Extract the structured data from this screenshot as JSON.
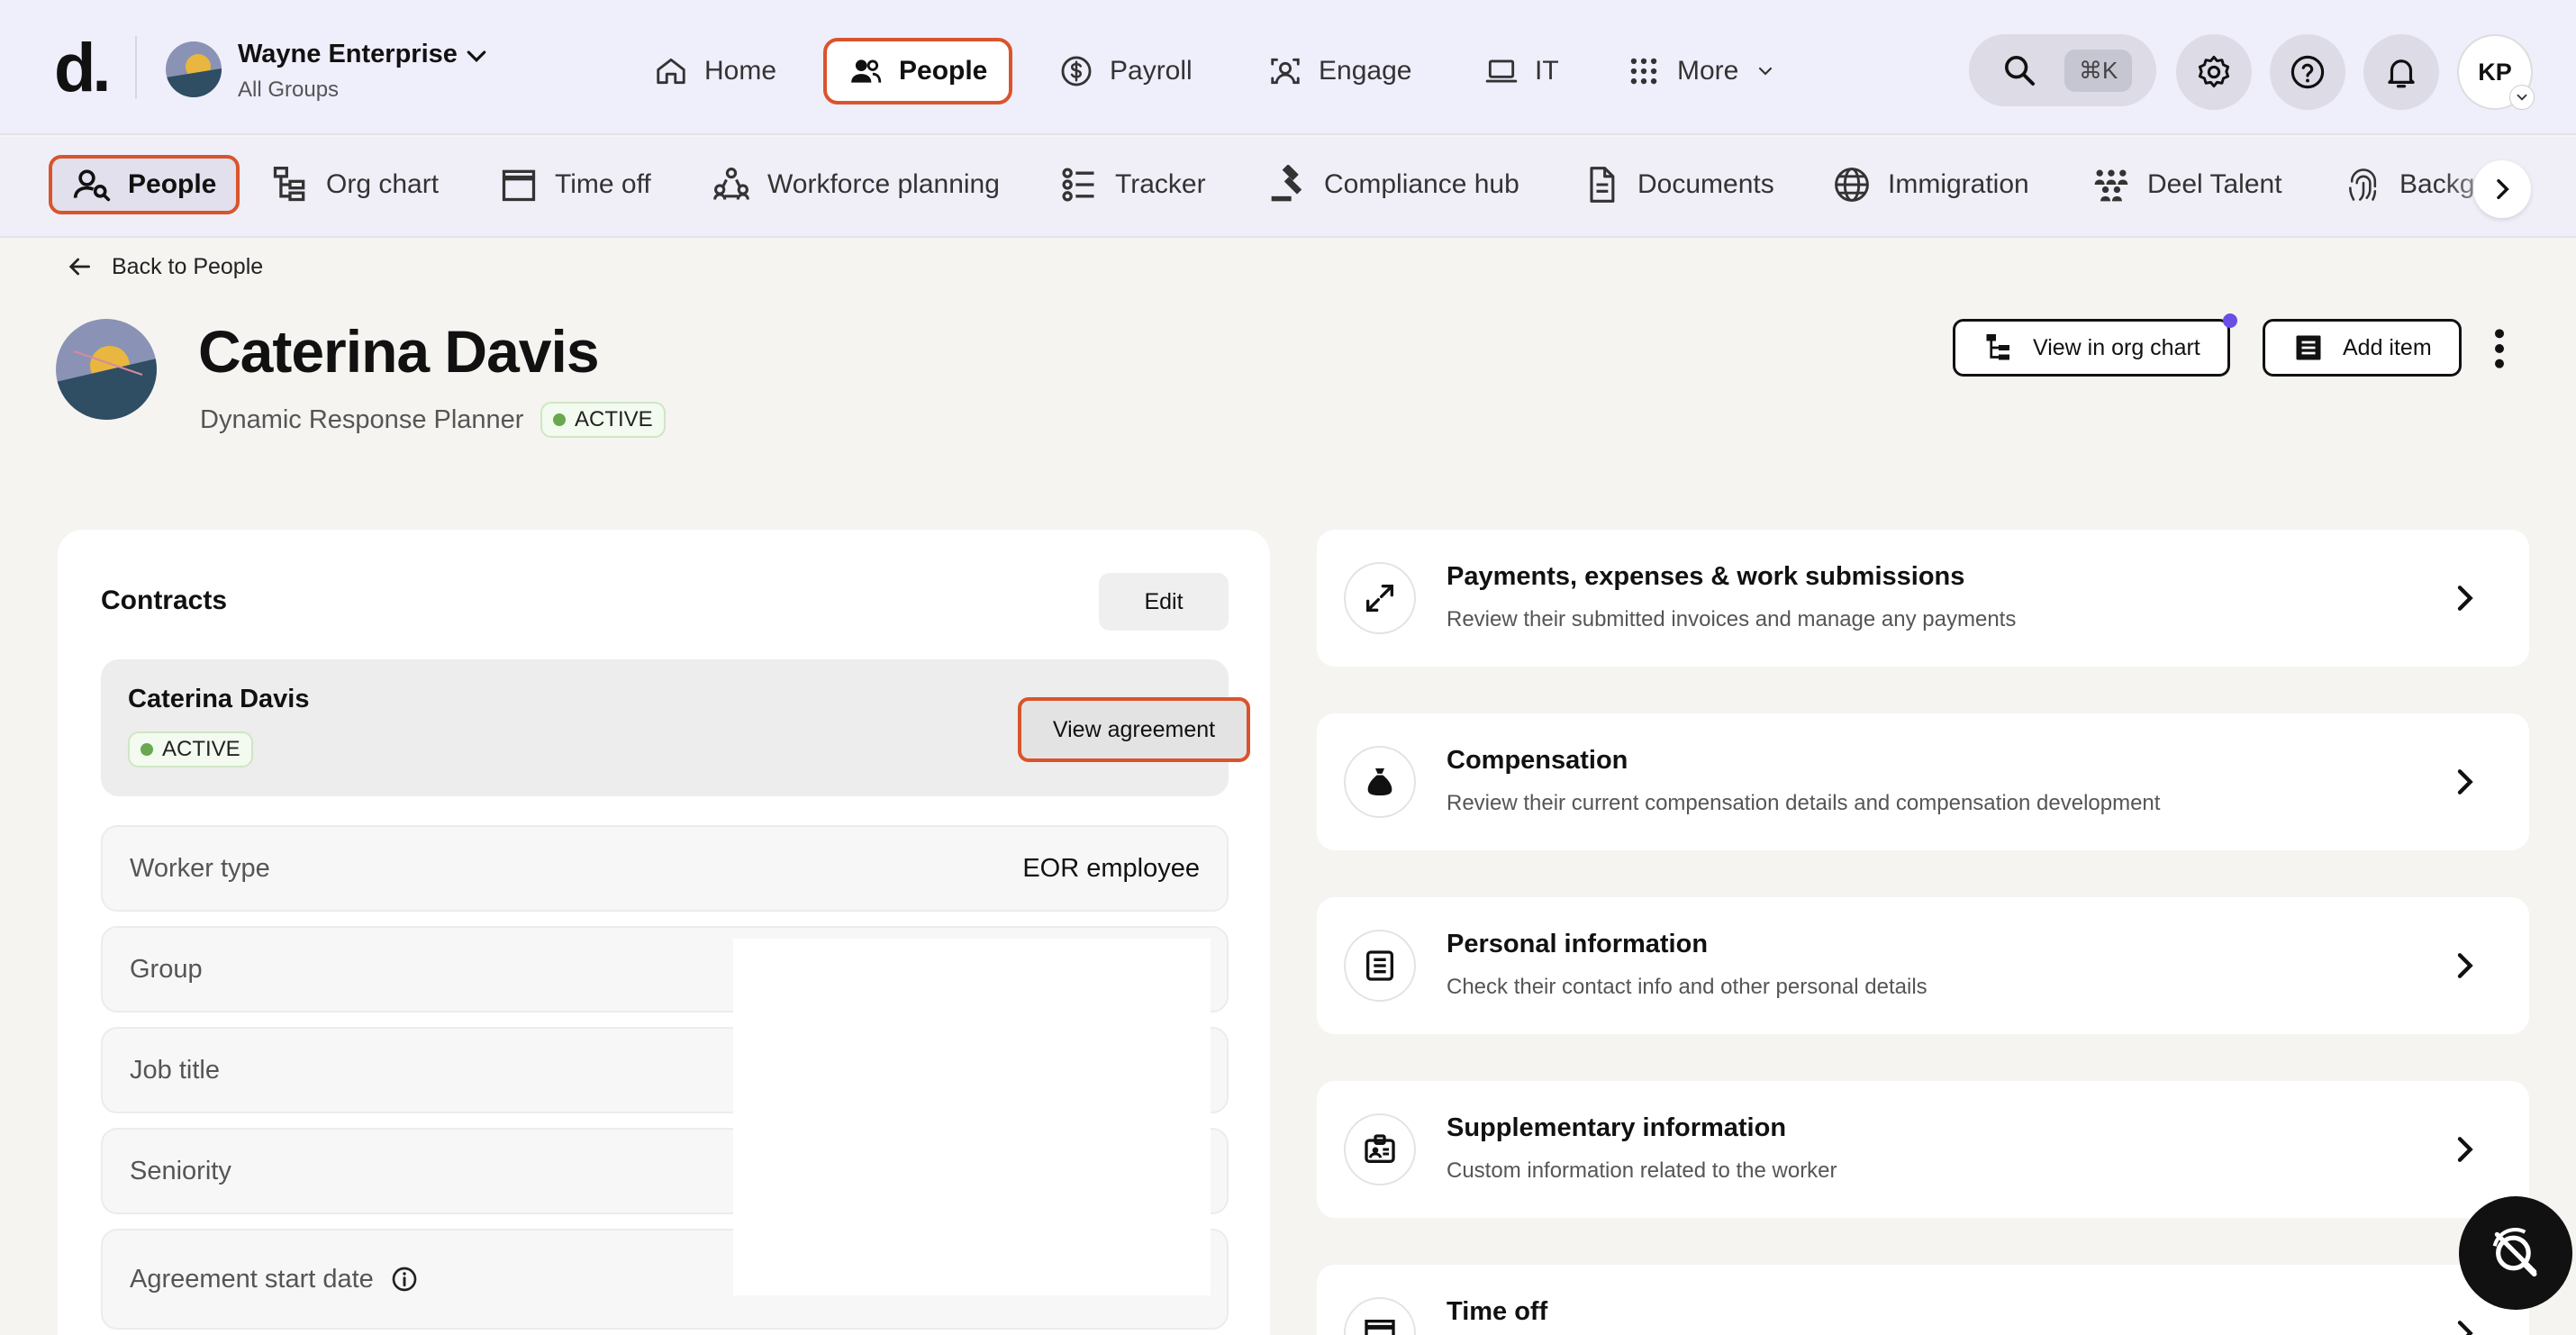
{
  "topbar": {
    "logo": "d.",
    "org_name": "Wayne Enterprise",
    "org_sub": "All Groups",
    "nav": [
      {
        "label": "Home",
        "icon": "home-icon"
      },
      {
        "label": "People",
        "icon": "people-icon",
        "active": true
      },
      {
        "label": "Payroll",
        "icon": "dollar-icon"
      },
      {
        "label": "Engage",
        "icon": "engage-icon"
      },
      {
        "label": "IT",
        "icon": "laptop-icon"
      },
      {
        "label": "More",
        "icon": "grid-icon"
      }
    ],
    "search_shortcut": "⌘K",
    "user_initials": "KP"
  },
  "subnav": {
    "items": [
      {
        "label": "People",
        "icon": "people-search-icon",
        "active": true
      },
      {
        "label": "Org chart",
        "icon": "org-chart-icon"
      },
      {
        "label": "Time off",
        "icon": "calendar-icon"
      },
      {
        "label": "Workforce planning",
        "icon": "workforce-icon"
      },
      {
        "label": "Tracker",
        "icon": "tracker-icon"
      },
      {
        "label": "Compliance hub",
        "icon": "gavel-icon"
      },
      {
        "label": "Documents",
        "icon": "document-icon"
      },
      {
        "label": "Immigration",
        "icon": "globe-icon"
      },
      {
        "label": "Deel Talent",
        "icon": "talent-icon"
      },
      {
        "label": "Backg",
        "icon": "fingerprint-icon"
      }
    ]
  },
  "profile": {
    "back_label": "Back to People",
    "name": "Caterina Davis",
    "role": "Dynamic Response Planner",
    "status": "ACTIVE",
    "view_org_chart": "View in org chart",
    "add_item": "Add item"
  },
  "contracts": {
    "title": "Contracts",
    "edit_label": "Edit",
    "contract_name": "Caterina Davis",
    "contract_status": "ACTIVE",
    "view_agreement": "View agreement",
    "fields": [
      {
        "label": "Worker type",
        "value": "EOR employee"
      },
      {
        "label": "Group",
        "value": ""
      },
      {
        "label": "Job title",
        "value": ""
      },
      {
        "label": "Seniority",
        "value": ""
      },
      {
        "label": "Agreement start date",
        "value": ""
      }
    ]
  },
  "sections": [
    {
      "title": "Payments, expenses & work submissions",
      "desc": "Review their submitted invoices and manage any payments",
      "icon": "arrows-expand-icon"
    },
    {
      "title": "Compensation",
      "desc": "Review their current compensation details and compensation development",
      "icon": "money-bag-icon"
    },
    {
      "title": "Personal information",
      "desc": "Check their contact info and other personal details",
      "icon": "note-icon"
    },
    {
      "title": "Supplementary information",
      "desc": "Custom information related to the worker",
      "icon": "id-badge-icon"
    },
    {
      "title": "Time off",
      "desc": "",
      "icon": "calendar-icon"
    }
  ],
  "colors": {
    "accent": "#d9542c",
    "topbar_bg": "#efeefb",
    "active_green": "#6aa84f",
    "notif_purple": "#6b4ee6"
  }
}
